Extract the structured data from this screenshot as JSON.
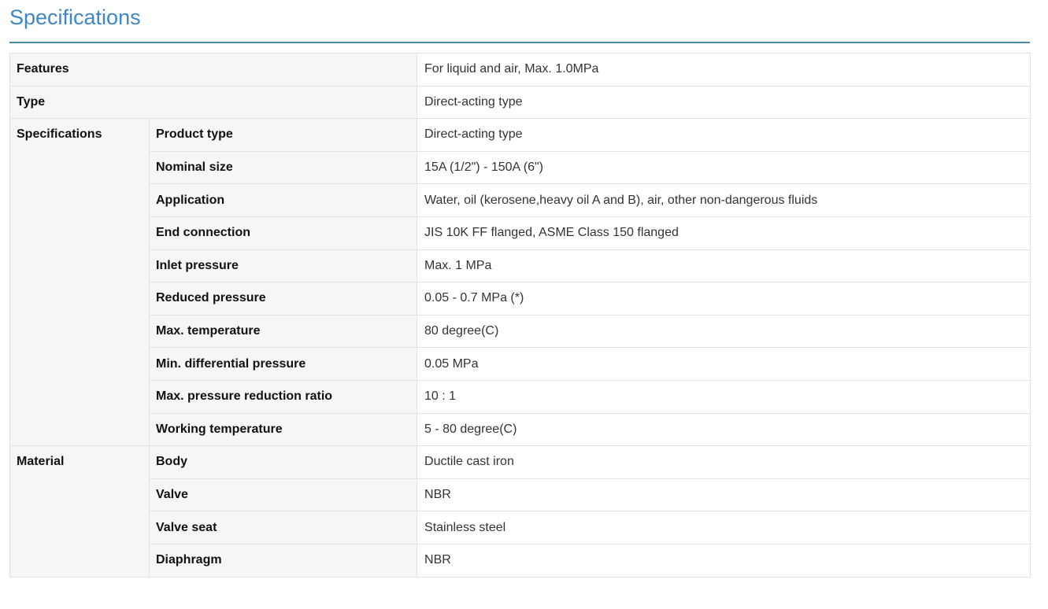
{
  "header": {
    "title": "Specifications"
  },
  "table": {
    "features": {
      "label": "Features",
      "value": "For liquid and air, Max. 1.0MPa"
    },
    "type": {
      "label": "Type",
      "value": "Direct-acting type"
    },
    "specifications": {
      "group_label": "Specifications",
      "rows": [
        {
          "label": "Product type",
          "value": "Direct-acting type"
        },
        {
          "label": "Nominal size",
          "value": "15A (1/2\") - 150A (6\")"
        },
        {
          "label": "Application",
          "value": "Water, oil (kerosene,heavy oil A and B), air, other non-dangerous fluids"
        },
        {
          "label": "End connection",
          "value": "JIS 10K FF flanged, ASME Class 150 flanged"
        },
        {
          "label": "Inlet pressure",
          "value": "Max. 1 MPa"
        },
        {
          "label": "Reduced pressure",
          "value": "0.05 - 0.7 MPa (*)"
        },
        {
          "label": "Max. temperature",
          "value": "80 degree(C)"
        },
        {
          "label": "Min. differential pressure",
          "value": "0.05 MPa"
        },
        {
          "label": "Max. pressure reduction ratio",
          "value": "10 : 1"
        },
        {
          "label": "Working temperature",
          "value": "5 - 80 degree(C)"
        }
      ]
    },
    "material": {
      "group_label": "Material",
      "rows": [
        {
          "label": "Body",
          "value": "Ductile cast iron"
        },
        {
          "label": "Valve",
          "value": "NBR"
        },
        {
          "label": "Valve seat",
          "value": "Stainless steel"
        },
        {
          "label": "Diaphragm",
          "value": "NBR"
        }
      ]
    }
  }
}
